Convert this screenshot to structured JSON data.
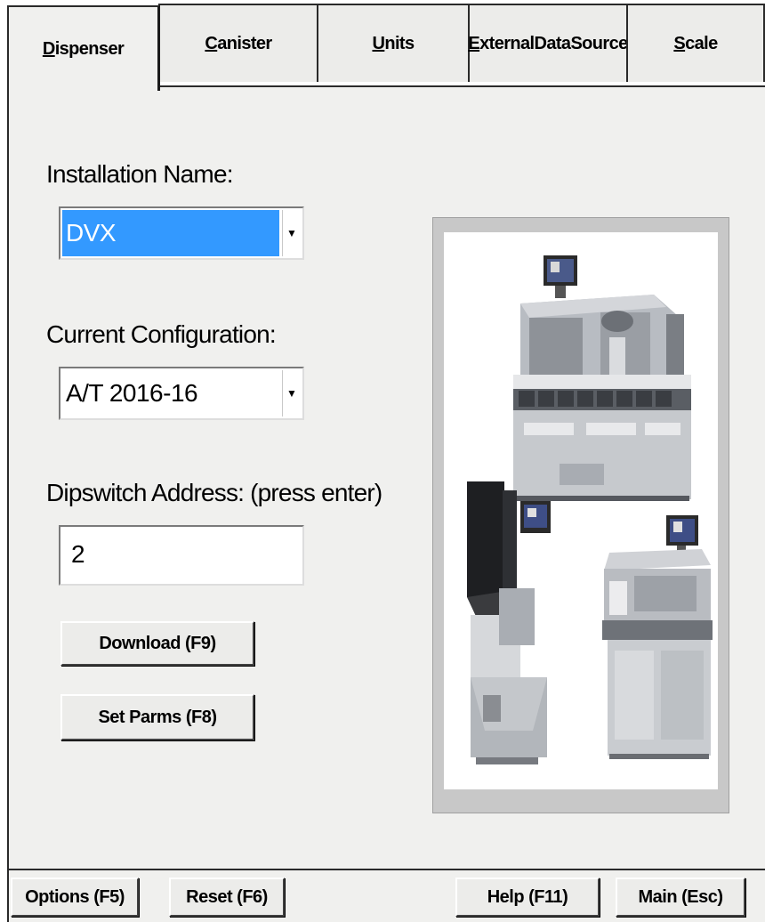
{
  "tabs": [
    {
      "label": "Dispenser",
      "underline": "D",
      "active": true
    },
    {
      "label": "Canister",
      "underline": "C",
      "active": false
    },
    {
      "label": "Units",
      "underline": "U",
      "active": false
    },
    {
      "label": "ExternalDataSource",
      "underline": "E",
      "active": false
    },
    {
      "label": "Scale",
      "underline": "S",
      "active": false
    }
  ],
  "form": {
    "installation_label": "Installation Name:",
    "installation_value": "DVX",
    "configuration_label": "Current Configuration:",
    "configuration_value": "A/T 2016-16",
    "dipswitch_label": "Dipswitch Address: (press enter)",
    "dipswitch_value": "2",
    "download_label": "Download (F9)",
    "setparms_label": "Set Parms (F8)"
  },
  "footer": {
    "options_label": "Options (F5)",
    "reset_label": "Reset (F6)",
    "help_label": "Help (F11)",
    "main_label": "Main (Esc)"
  },
  "colors": {
    "selection": "#3399ff",
    "panel": "#f0f0ee",
    "image_frame": "#c8c8c8"
  }
}
